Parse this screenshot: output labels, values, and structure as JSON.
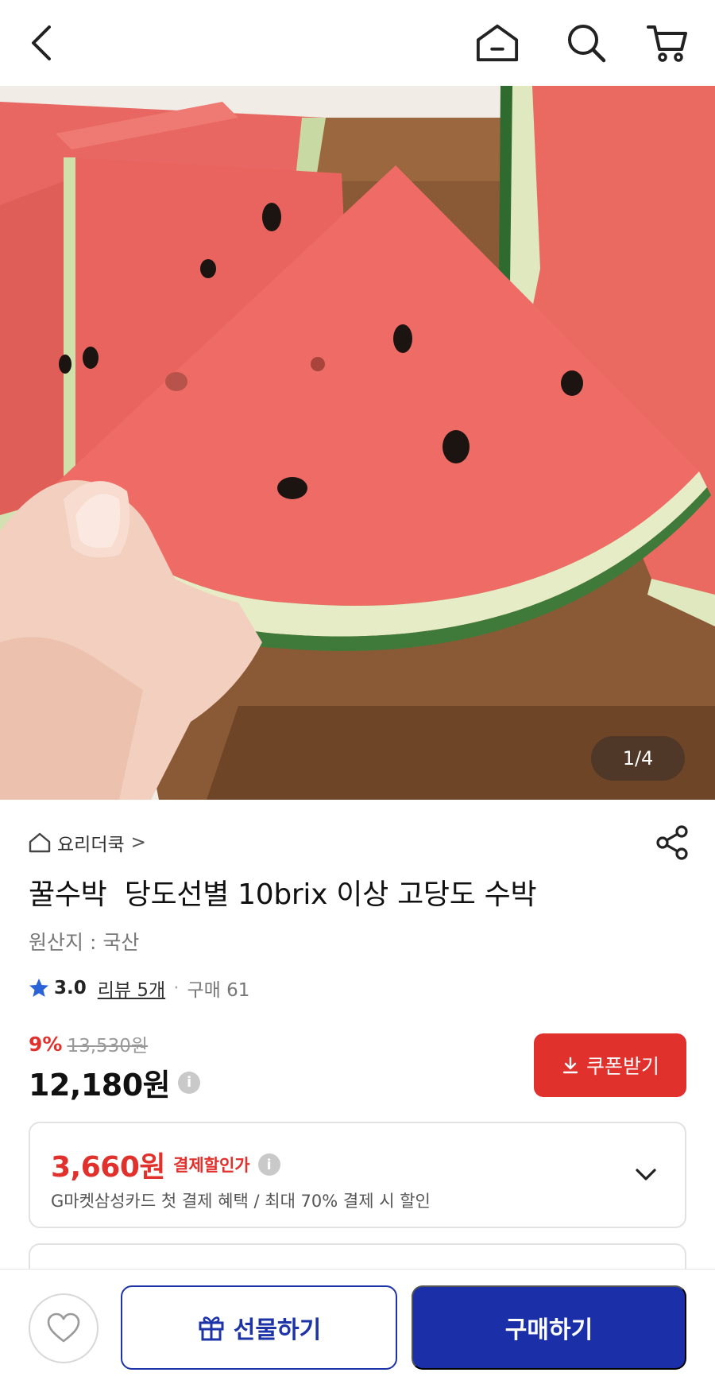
{
  "header": {
    "back_icon": "chevron-left-icon",
    "home_icon": "home-icon",
    "search_icon": "search-icon",
    "cart_icon": "cart-icon"
  },
  "gallery": {
    "counter": "1/4",
    "image_subject": "watermelon slice"
  },
  "product": {
    "store_name": "요리더쿡",
    "store_chevron": ">",
    "title": "꿀수박  당도선별 10brix 이상 고당도 수박",
    "origin": "원산지 : 국산",
    "rating": "3.0",
    "review_link": "리뷰 5개",
    "separator": "·",
    "purchase_count": "구매 61",
    "discount_rate": "9%",
    "original_price": "13,530원",
    "price": "12,180원",
    "info_mark": "i",
    "coupon_button": "쿠폰받기"
  },
  "payment_benefit": {
    "amount": "3,660원",
    "label": "결제할인가",
    "info_mark": "i",
    "description": "G마켓삼성카드 첫 결제 혜택 / 최대 70% 결제 시 할인"
  },
  "bottom_bar": {
    "wishlist_icon": "heart-icon",
    "gift_button": "선물하기",
    "buy_button": "구매하기"
  },
  "colors": {
    "accent_red": "#e0312c",
    "brand_blue": "#1a2fa8",
    "star_blue": "#2a62d8"
  }
}
